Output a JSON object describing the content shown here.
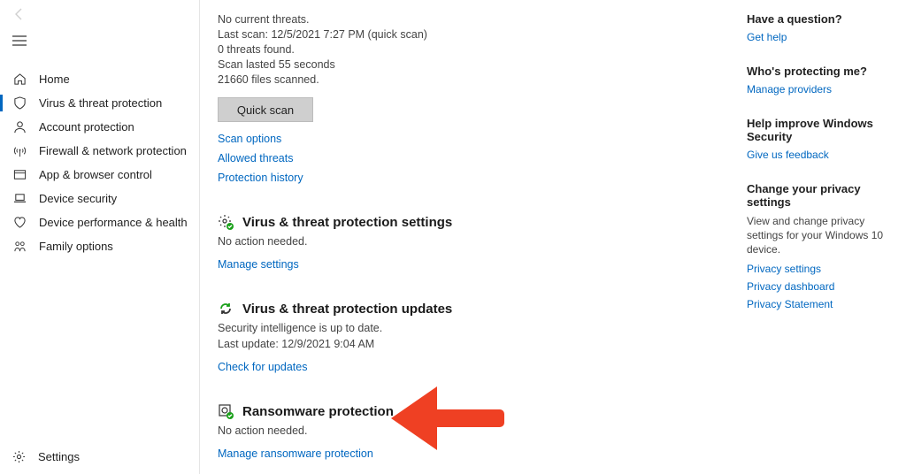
{
  "sidebar": {
    "items": [
      {
        "label": "Home"
      },
      {
        "label": "Virus & threat protection"
      },
      {
        "label": "Account protection"
      },
      {
        "label": "Firewall & network protection"
      },
      {
        "label": "App & browser control"
      },
      {
        "label": "Device security"
      },
      {
        "label": "Device performance & health"
      },
      {
        "label": "Family options"
      }
    ],
    "settings_label": "Settings"
  },
  "scan": {
    "l1": "No current threats.",
    "l2": "Last scan: 12/5/2021 7:27 PM (quick scan)",
    "l3": "0 threats found.",
    "l4": "Scan lasted 55 seconds",
    "l5": "21660 files scanned.",
    "button": "Quick scan",
    "link_scan_options": "Scan options",
    "link_allowed": "Allowed threats",
    "link_history": "Protection history"
  },
  "settings_section": {
    "title": "Virus & threat protection settings",
    "sub": "No action needed.",
    "link": "Manage settings"
  },
  "updates_section": {
    "title": "Virus & threat protection updates",
    "sub": "Security intelligence is up to date.",
    "sub2": "Last update: 12/9/2021 9:04 AM",
    "link": "Check for updates"
  },
  "ransomware_section": {
    "title": "Ransomware protection",
    "sub": "No action needed.",
    "link": "Manage ransomware protection"
  },
  "right": {
    "q_head": "Have a question?",
    "q_link": "Get help",
    "who_head": "Who's protecting me?",
    "who_link": "Manage providers",
    "improve_head": "Help improve Windows Security",
    "improve_link": "Give us feedback",
    "privacy_head": "Change your privacy settings",
    "privacy_text": "View and change privacy settings for your Windows 10 device.",
    "privacy_link1": "Privacy settings",
    "privacy_link2": "Privacy dashboard",
    "privacy_link3": "Privacy Statement"
  }
}
